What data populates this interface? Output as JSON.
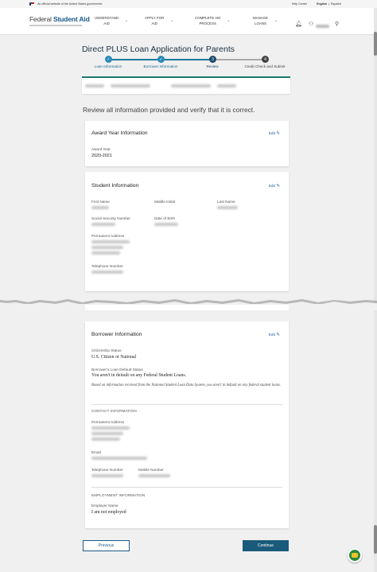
{
  "gov_banner": {
    "text": "An official website of the United States government.",
    "help": "Help Center",
    "english": "English",
    "espanol": "Español",
    "separator": "|"
  },
  "header": {
    "logo_prefix": "Federal ",
    "logo_brand": "Student Aid",
    "nav": [
      {
        "line1": "UNDERSTAND",
        "line2": "AID"
      },
      {
        "line1": "APPLY FOR",
        "line2": "AID"
      },
      {
        "line1": "COMPLETE AID",
        "line2": "PROCESS"
      },
      {
        "line1": "MANAGE",
        "line2": "LOANS"
      }
    ]
  },
  "page_title": "Direct PLUS Loan Application for Parents",
  "steps": [
    {
      "label": "Loan Information",
      "state": "complete",
      "icon": "check-icon",
      "symbol": "✓"
    },
    {
      "label": "Borrower Information",
      "state": "complete",
      "icon": "check-icon",
      "symbol": "✓"
    },
    {
      "label": "Review",
      "state": "current",
      "number": "3"
    },
    {
      "label": "Credit Check and Submit",
      "state": "upcoming",
      "number": "4"
    }
  ],
  "review_text": "Review all information provided and verify that it is correct.",
  "edit_label": "Edit",
  "award_card": {
    "title": "Award Year Information",
    "award_year_label": "Award Year",
    "award_year_value": "2020-2021"
  },
  "student_card": {
    "title": "Student Information",
    "first_name_label": "First Name",
    "middle_label": "Middle Initial",
    "last_name_label": "Last Name",
    "ssn_label": "Social Security Number",
    "dob_label": "Date of Birth",
    "address_label": "Permanent Address",
    "phone_label": "Telephone Number"
  },
  "borrower_card": {
    "title": "Borrower Information",
    "citizenship_label": "Citizenship Status",
    "citizenship_value": "U.S. Citizen or National",
    "default_label": "Borrower's Loan Default Status",
    "default_value": "You aren't in default on any Federal Student Loans.",
    "default_note": "Based on information received from the National Student Loan Data System, you aren't in default on any federal student loans.",
    "contact_header": "CONTACT INFORMATION",
    "address_label": "Permanent Address",
    "email_label": "Email",
    "phone_label": "Telephone Number",
    "mobile_label": "Mobile Number",
    "employment_header": "EMPLOYMENT INFORMATION",
    "employer_label": "Employer Name",
    "employer_value": "I am not employed"
  },
  "buttons": {
    "previous": "Previous",
    "continue": "Continue"
  },
  "colors": {
    "brand": "#1a5a8a",
    "accent": "#1a7a9a",
    "continue_bg": "#1a5a7a"
  },
  "icons": {
    "search": "search-icon",
    "bell": "bell-icon",
    "user": "user-icon",
    "edit": "edit-icon",
    "chat": "chat-icon"
  }
}
